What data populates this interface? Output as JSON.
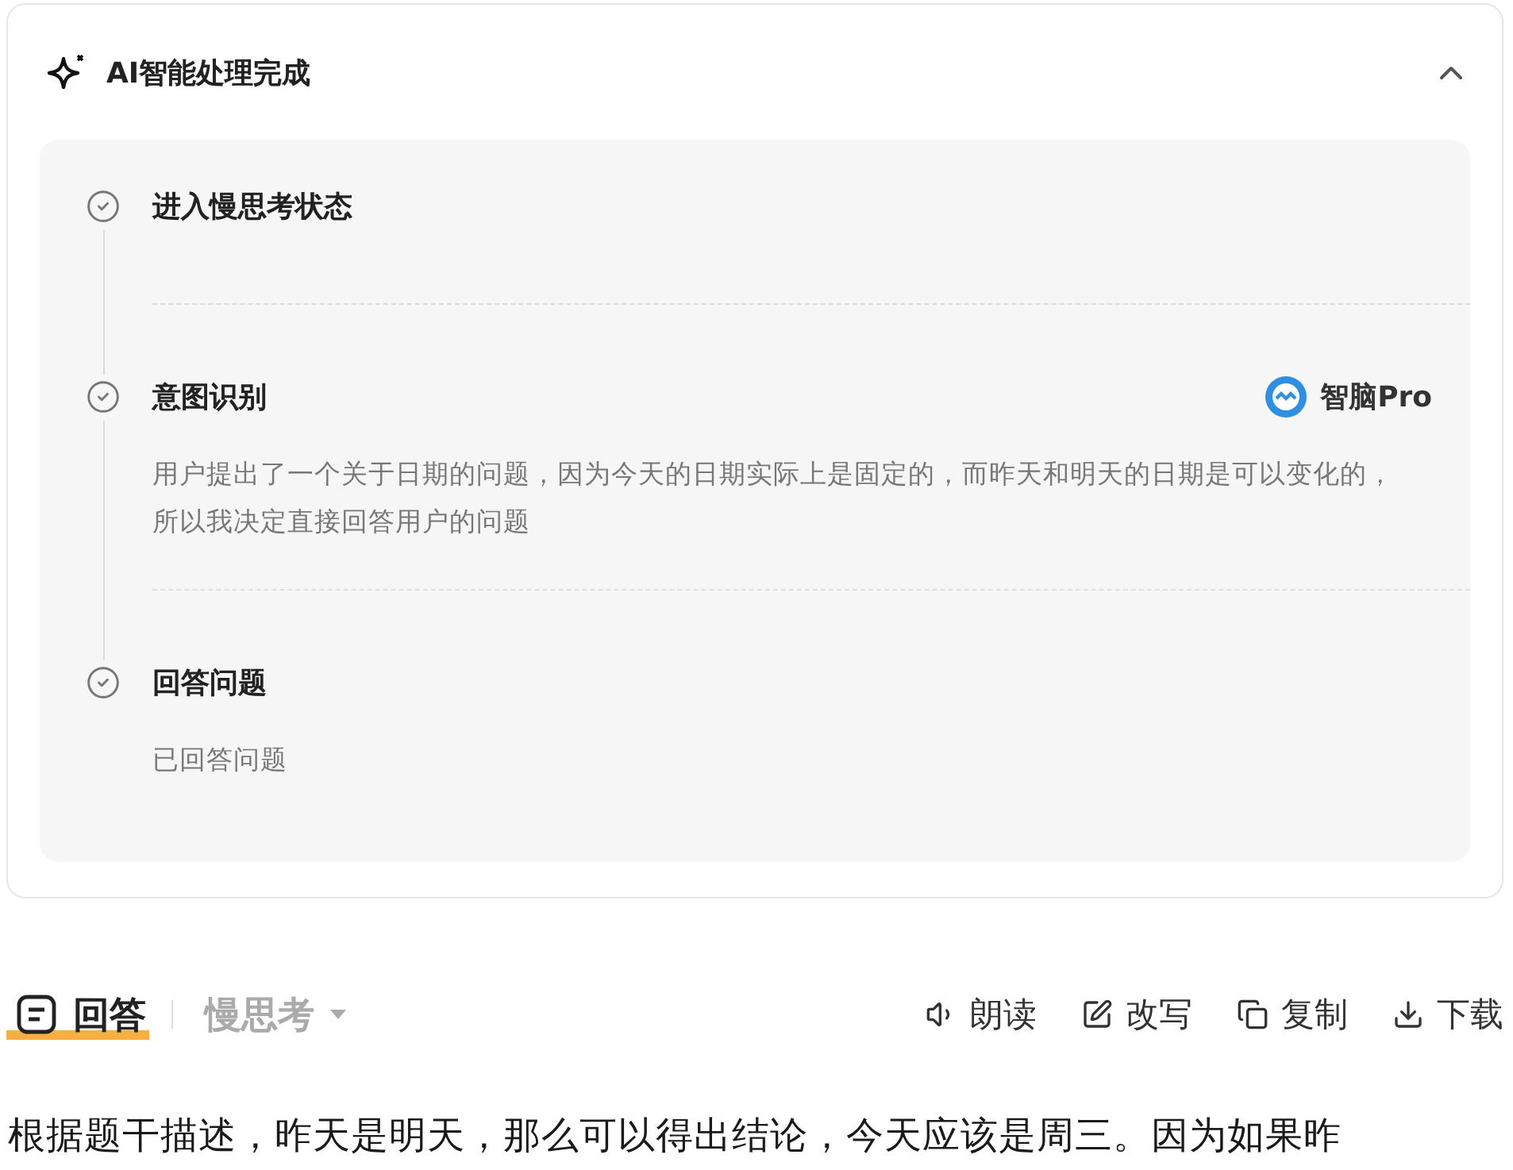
{
  "panel": {
    "title": "AI智能处理完成",
    "expanded": true,
    "steps": [
      {
        "title": "进入慢思考状态",
        "done": true
      },
      {
        "title": "意图识别",
        "done": true,
        "badge": "智脑Pro",
        "body": "用户提出了一个关于日期的问题，因为今天的日期实际上是固定的，而昨天和明天的日期是可以变化的，所以我决定直接回答用户的问题"
      },
      {
        "title": "回答问题",
        "done": true,
        "body": "已回答问题"
      }
    ]
  },
  "tabs": [
    {
      "label": "回答",
      "selected": true,
      "kind": "answer"
    },
    {
      "label": "慢思考",
      "selected": false,
      "kind": "dropdown"
    }
  ],
  "actions": [
    {
      "label": "朗读",
      "kind": "read"
    },
    {
      "label": "改写",
      "kind": "rewrite"
    },
    {
      "label": "复制",
      "kind": "copy"
    },
    {
      "label": "下载",
      "kind": "download"
    }
  ],
  "answer": "根据题干描述，昨天是明天，那么可以得出结论，今天应该是周三。因为如果昨"
}
